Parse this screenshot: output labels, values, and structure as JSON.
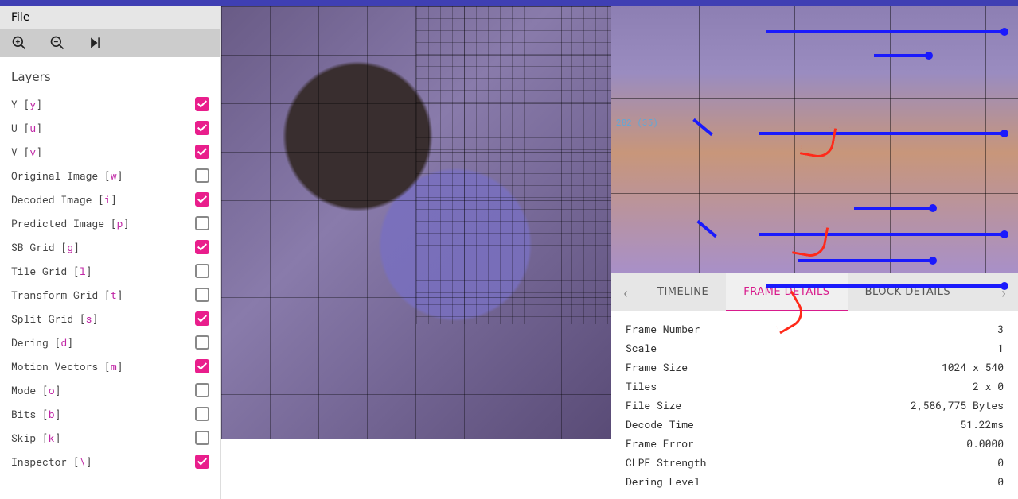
{
  "menu": {
    "file": "File"
  },
  "layers": {
    "header": "Layers",
    "items": [
      {
        "label": "Y",
        "hotkey": "y",
        "checked": true
      },
      {
        "label": "U",
        "hotkey": "u",
        "checked": true
      },
      {
        "label": "V",
        "hotkey": "v",
        "checked": true
      },
      {
        "label": "Original Image",
        "hotkey": "w",
        "checked": false
      },
      {
        "label": "Decoded Image",
        "hotkey": "i",
        "checked": true
      },
      {
        "label": "Predicted Image",
        "hotkey": "p",
        "checked": false
      },
      {
        "label": "SB Grid",
        "hotkey": "g",
        "checked": true
      },
      {
        "label": "Tile Grid",
        "hotkey": "l",
        "checked": false
      },
      {
        "label": "Transform Grid",
        "hotkey": "t",
        "checked": false
      },
      {
        "label": "Split Grid",
        "hotkey": "s",
        "checked": true
      },
      {
        "label": "Dering",
        "hotkey": "d",
        "checked": false
      },
      {
        "label": "Motion Vectors",
        "hotkey": "m",
        "checked": true
      },
      {
        "label": "Mode",
        "hotkey": "o",
        "checked": false
      },
      {
        "label": "Bits",
        "hotkey": "b",
        "checked": false
      },
      {
        "label": "Skip",
        "hotkey": "k",
        "checked": false
      },
      {
        "label": "Inspector",
        "hotkey": "\\",
        "checked": true
      }
    ]
  },
  "zoom": {
    "cursor_label": "282 (35)"
  },
  "tabs": {
    "prev_icon": "‹",
    "next_icon": "›",
    "items": [
      {
        "label": "TIMELINE",
        "active": false
      },
      {
        "label": "FRAME DETAILS",
        "active": true
      },
      {
        "label": "BLOCK DETAILS",
        "active": false
      }
    ]
  },
  "details": [
    {
      "key": "Frame Number",
      "val": "3"
    },
    {
      "key": "Scale",
      "val": "1"
    },
    {
      "key": "Frame Size",
      "val": "1024 x 540"
    },
    {
      "key": "Tiles",
      "val": "2 x 0"
    },
    {
      "key": "File Size",
      "val": "2,586,775 Bytes"
    },
    {
      "key": "Decode Time",
      "val": "51.22ms"
    },
    {
      "key": "Frame Error",
      "val": "0.0000"
    },
    {
      "key": "CLPF Strength",
      "val": "0"
    },
    {
      "key": "Dering Level",
      "val": "0"
    }
  ]
}
